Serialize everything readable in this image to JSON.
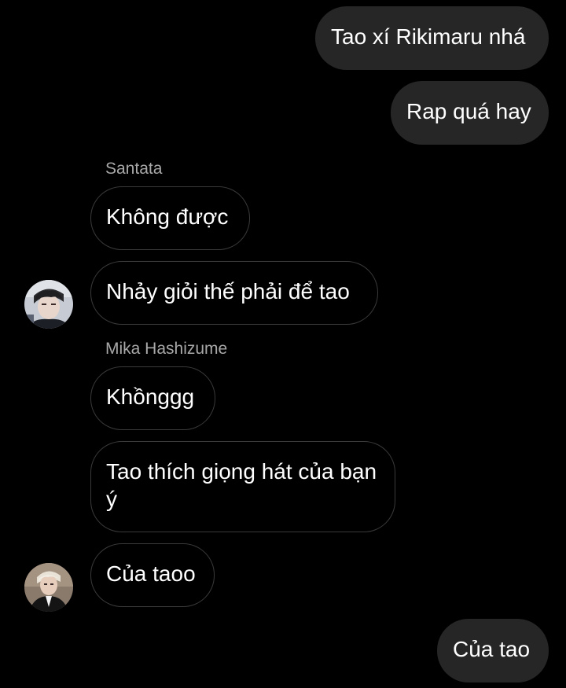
{
  "messages": {
    "m1": "Tao xí Rikimaru nhá",
    "m2": "Rap quá hay",
    "sender1": "Santata",
    "m3": "Không được",
    "m4": "Nhảy giỏi thế phải để tao",
    "sender2": "Mika Hashizume",
    "m5": "Khồnggg",
    "m6": "Tao thích giọng hát của bạn ý",
    "m7": "Của taoo",
    "m8": "Của tao"
  },
  "avatars": {
    "santata": "avatar-santata",
    "mika": "avatar-mika"
  },
  "colors": {
    "background": "#000000",
    "outgoing_bubble": "#262626",
    "incoming_border": "#3a3a3a",
    "sender_name": "#a8a8a8",
    "text": "#ffffff"
  }
}
